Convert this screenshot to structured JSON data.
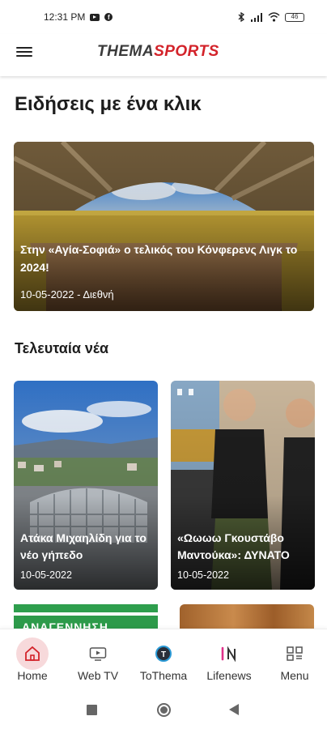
{
  "status_bar": {
    "time": "12:31 PM",
    "battery": "46"
  },
  "header": {
    "logo_part1": "THEMA",
    "logo_part2": "SPORTS",
    "menu_icon": "hamburger-icon"
  },
  "main": {
    "title": "Ειδήσεις με ένα κλικ",
    "hero": {
      "headline": "Στην «Αγία-Σοφιά» ο τελικός του Κόνφερενς Λιγκ το 2024!",
      "meta": "10-05-2022 - Διεθνή"
    },
    "latest_title": "Τελευταία νέα",
    "cards": [
      {
        "headline": "Ατάκα Μιχαηλίδη για το νέο γήπεδο",
        "date": "10-05-2022"
      },
      {
        "headline": "«Ωωωω Γκουστάβο Μαντούκα»: ΔΥΝΑΤΟ",
        "date": "10-05-2022"
      }
    ],
    "peek_left_text": "ΑΝΑΓΕΝΝΗΣΗ"
  },
  "bottom_nav": {
    "items": [
      {
        "label": "Home",
        "icon": "home-icon"
      },
      {
        "label": "Web TV",
        "icon": "tv-icon"
      },
      {
        "label": "ToThema",
        "icon": "tothema-icon"
      },
      {
        "label": "Lifenews",
        "icon": "lifenews-icon"
      },
      {
        "label": "Menu",
        "icon": "menu-grid-icon"
      }
    ],
    "active_color": "#d3232a"
  }
}
